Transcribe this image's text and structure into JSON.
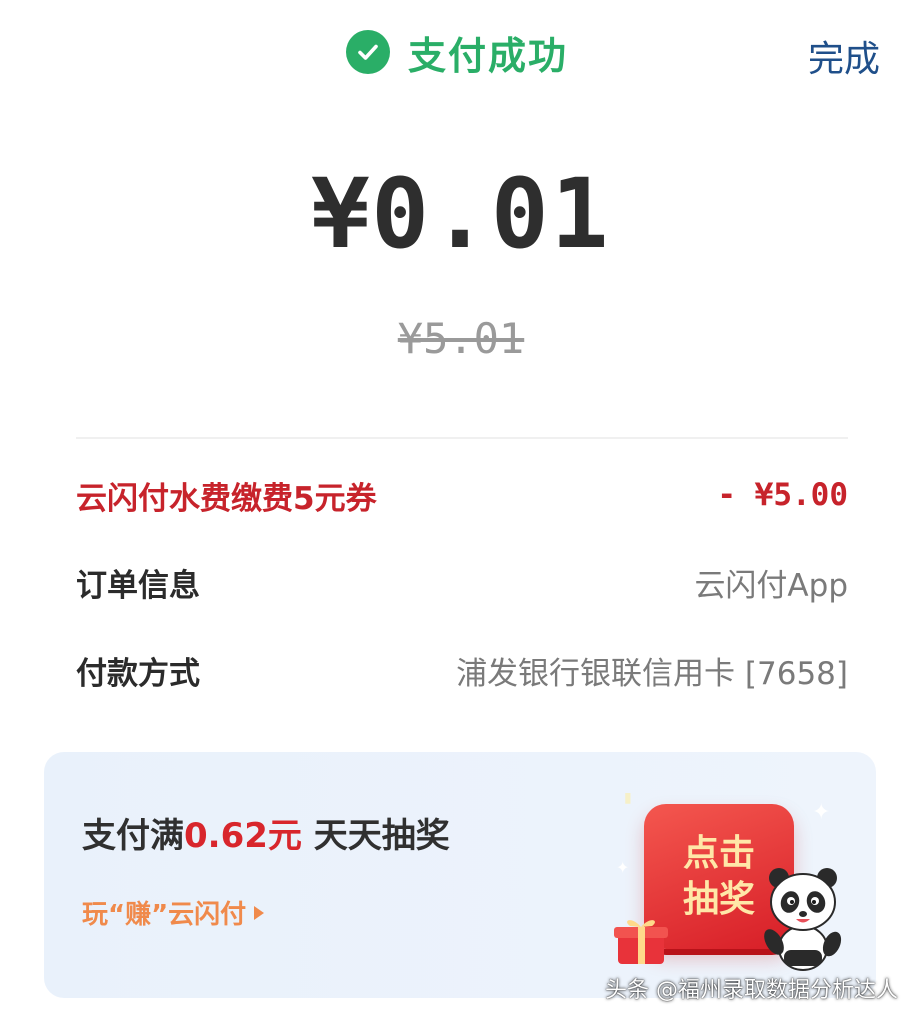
{
  "header": {
    "status_title": "支付成功",
    "done_label": "完成"
  },
  "payment": {
    "amount": "¥0.01",
    "original_amount": "¥5.01"
  },
  "details": [
    {
      "label": "云闪付水费缴费5元券",
      "value": "- ¥5.00"
    },
    {
      "label": "订单信息",
      "value": "云闪付App"
    },
    {
      "label": "付款方式",
      "value": "浦发银行银联信用卡 [7658]"
    }
  ],
  "banner": {
    "title_prefix": "支付满",
    "title_highlight": "0.62元",
    "title_suffix": " 天天抽奖",
    "link_label": "玩“赚”云闪付",
    "prize_button_label": "点击抽奖"
  },
  "watermark": "头条 @福州录取数据分析达人",
  "colors": {
    "success": "#2aae67",
    "accent_red": "#c7232b",
    "link_blue": "#1f4f8a",
    "orange": "#f08a4b"
  }
}
